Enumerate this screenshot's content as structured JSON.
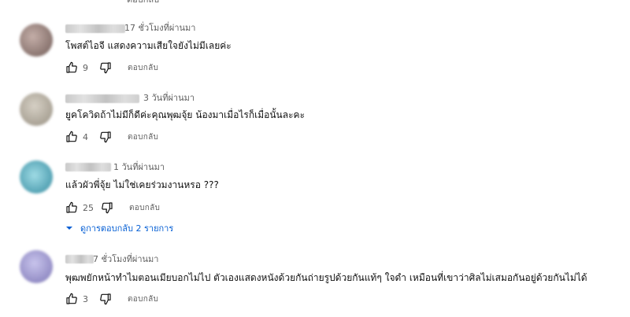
{
  "top_reply_fragment": "ตอบกลับ",
  "comments": [
    {
      "time": "17 ชั่วโมงที่ผ่านมา",
      "text": "โพสต์ไอจี แสดงความเสียใจยังไม่มีเลยค่ะ",
      "likes": "9",
      "reply_label": "ตอบกลับ",
      "avatar_color": "#9b8a86"
    },
    {
      "time": "3 วันที่ผ่านมา",
      "text": "ยูคโควิดถ้าไม่มีก็ดีค่ะคุณพุฒจุ้ย น้องมาเมื่อไรก็เมื่อนั้นละคะ",
      "likes": "4",
      "reply_label": "ตอบกลับ",
      "avatar_color": "#b8b2a6"
    },
    {
      "time": "1 วันที่ผ่านมา",
      "text": "แล้วผัวพี่จุ้ย   ไม่ใช่เคยร่วมงานหรอ ???",
      "likes": "25",
      "reply_label": "ตอบกลับ",
      "avatar_color": "#6fb6c4"
    },
    {
      "time": "7 ชั่วโมงที่ผ่านมา",
      "text": "พุฒพยักหน้าทำไมตอนเมียบอกไม่ไป ตัวเองแสดงหนังด้วยกันถ่ายรูปด้วยกันแท้ๆ ใจดำ  เหมือนที่เขาว่าศิลไม่เสมอกันอยู่ด้วยกันไม่ได้",
      "likes": "3",
      "reply_label": "ตอบกลับ",
      "avatar_color": "#a7a2cf"
    }
  ],
  "view_replies_label": "ดูการตอบกลับ 2 รายการ",
  "colors": {
    "link": "#065fd4",
    "secondary_text": "#606060",
    "primary_text": "#0f0f0f"
  }
}
